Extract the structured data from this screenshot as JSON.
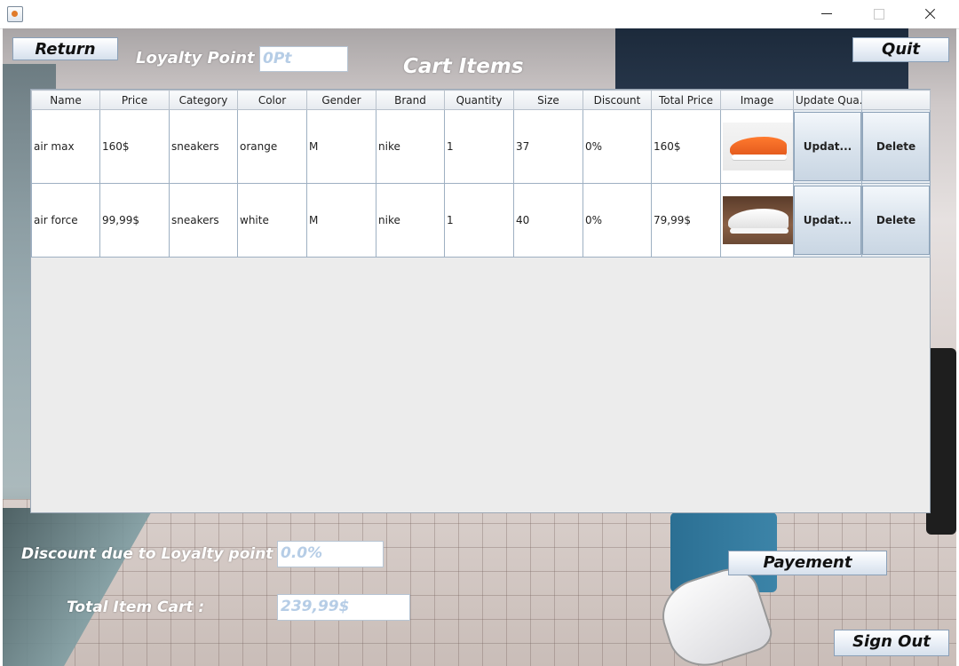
{
  "window": {
    "title": ""
  },
  "header": {
    "return_label": "Return",
    "quit_label": "Quit",
    "loyalty_label": "Loyalty Point :",
    "loyalty_value": "0Pt",
    "title": "Cart Items"
  },
  "table": {
    "columns": [
      "Name",
      "Price",
      "Category",
      "Color",
      "Gender",
      "Brand",
      "Quantity",
      "Size",
      "Discount",
      "Total Price",
      "Image",
      "Update Qua...",
      ""
    ],
    "rows": [
      {
        "name": "air max",
        "price": "160$",
        "category": "sneakers",
        "color": "orange",
        "gender": "M",
        "brand": "nike",
        "quantity": "1",
        "size": "37",
        "discount": "0%",
        "total": "160$",
        "image": "orange-sneaker-image",
        "update_label": "Updat...",
        "delete_label": "Delete"
      },
      {
        "name": "air force",
        "price": "99,99$",
        "category": "sneakers",
        "color": "white",
        "gender": "M",
        "brand": "nike",
        "quantity": "1",
        "size": "40",
        "discount": "0%",
        "total": "79,99$",
        "image": "white-sneaker-image",
        "update_label": "Updat...",
        "delete_label": "Delete"
      }
    ]
  },
  "footer": {
    "discount_label": "Discount due to Loyalty point :",
    "discount_value": "0.0%",
    "total_label": "Total Item Cart :",
    "total_value": "239,99$",
    "payment_label": "Payement",
    "signout_label": "Sign Out"
  }
}
